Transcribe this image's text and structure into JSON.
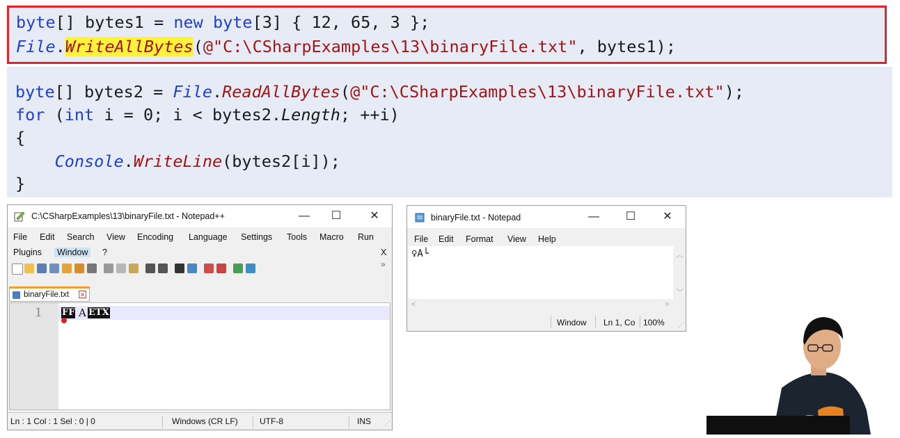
{
  "code": {
    "box": {
      "line1": {
        "kw": "byte",
        "rest1": "[] bytes1 = ",
        "kw2": "new",
        "sp": " ",
        "kw3": "byte",
        "rest2": "[3] { 12, 65, 3 };"
      },
      "line2": {
        "type": "File",
        "dot": ".",
        "method": "WriteAllBytes",
        "open": "(",
        "str": "@\"C:\\CSharpExamples\\13\\binaryFile.txt\"",
        "rest": ", bytes1);"
      }
    },
    "area": {
      "line1": {
        "kw": "byte",
        "rest1": "[] bytes2 = ",
        "type": "File",
        "dot": ".",
        "method": "ReadAllBytes",
        "open": "(",
        "str": "@\"C:\\CSharpExamples\\13\\binaryFile.txt\"",
        "rest": ");"
      },
      "line2": {
        "kw": "for",
        "rest1": " (",
        "kw2": "int",
        "rest2": " i = 0; i < bytes2.",
        "prop": "Length",
        "rest3": "; ++i)"
      },
      "line3": "{",
      "line4": {
        "indent": "    ",
        "type": "Console",
        "dot": ".",
        "method": "WriteLine",
        "rest": "(bytes2[i]);"
      },
      "line5": "}"
    }
  },
  "notepadpp": {
    "title": "C:\\CSharpExamples\\13\\binaryFile.txt - Notepad++",
    "menu1": [
      "File",
      "Edit",
      "Search",
      "View",
      "Encoding",
      "Language",
      "Settings",
      "Tools",
      "Macro",
      "Run"
    ],
    "menu2": [
      "Plugins",
      "Window",
      "?"
    ],
    "menu_close": "X",
    "tab_label": "binaryFile.txt",
    "line_number": "1",
    "content": {
      "c1": "FF",
      "c2": "A",
      "c3": "ETX"
    },
    "status": {
      "pos": "Ln : 1    Col : 1    Sel : 0 | 0",
      "eol": "Windows (CR LF)",
      "enc": "UTF-8",
      "mode": "INS"
    }
  },
  "notepad": {
    "title": "binaryFile.txt - Notepad",
    "menu": [
      "File",
      "Edit",
      "Format",
      "View",
      "Help"
    ],
    "content": "♀A└",
    "status": {
      "window": "Window",
      "pos": "Ln 1, Co",
      "zoom": "100%"
    }
  },
  "window_controls": {
    "min": "—",
    "max": "☐",
    "close": "✕"
  },
  "colors": {
    "code_bg": "#e7ebf6",
    "highlight_border": "#e2242a",
    "keyword": "#1e3fcf",
    "method": "#a31515",
    "highlight": "#fff23c"
  }
}
